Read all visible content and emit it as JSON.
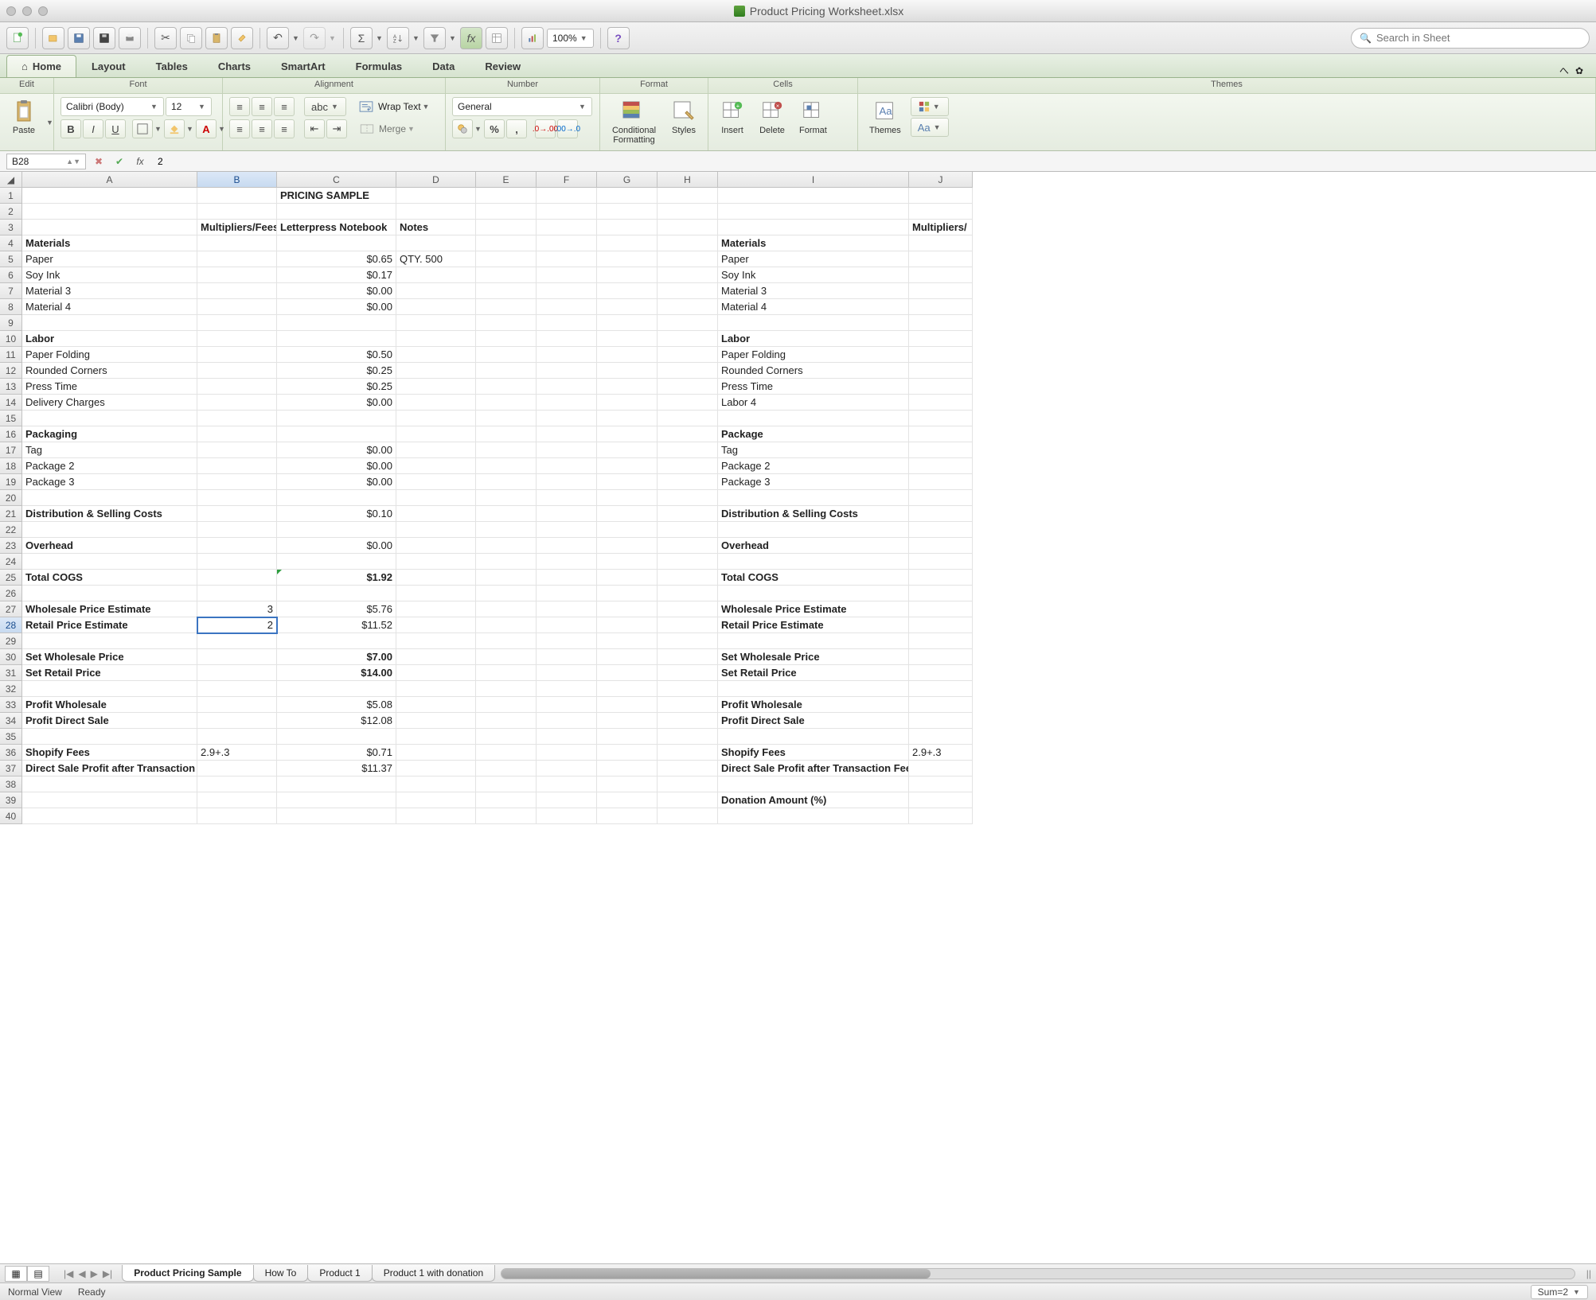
{
  "window": {
    "title": "Product Pricing Worksheet.xlsx"
  },
  "toolbar": {
    "zoom": "100%",
    "search_placeholder": "Search in Sheet"
  },
  "ribbon": {
    "tabs": [
      "Home",
      "Layout",
      "Tables",
      "Charts",
      "SmartArt",
      "Formulas",
      "Data",
      "Review"
    ],
    "active_tab": 0,
    "groups": [
      "Edit",
      "Font",
      "Alignment",
      "Number",
      "Format",
      "Cells",
      "Themes"
    ],
    "paste": "Paste",
    "font_name": "Calibri (Body)",
    "font_size": "12",
    "wrap_text": "Wrap Text",
    "merge": "Merge",
    "number_format": "General",
    "conditional_formatting": "Conditional\nFormatting",
    "styles": "Styles",
    "insert": "Insert",
    "delete": "Delete",
    "format": "Format",
    "themes": "Themes",
    "aa": "Aa"
  },
  "formula_bar": {
    "name_box": "B28",
    "formula": "2"
  },
  "columns": [
    "A",
    "B",
    "C",
    "D",
    "E",
    "F",
    "G",
    "H",
    "I",
    "J"
  ],
  "selected_cell": {
    "row": 28,
    "col": 1
  },
  "rows": [
    {
      "n": 1,
      "cells": {
        "C": {
          "v": "PRICING SAMPLE",
          "b": true
        }
      }
    },
    {
      "n": 2,
      "cells": {}
    },
    {
      "n": 3,
      "cells": {
        "B": {
          "v": "Multipliers/Fees",
          "b": true
        },
        "C": {
          "v": "Letterpress Notebook",
          "b": true
        },
        "D": {
          "v": "Notes",
          "b": true
        },
        "J": {
          "v": "Multipliers/",
          "b": true
        }
      }
    },
    {
      "n": 4,
      "cells": {
        "A": {
          "v": "Materials",
          "b": true
        },
        "I": {
          "v": "Materials",
          "b": true
        }
      }
    },
    {
      "n": 5,
      "cells": {
        "A": {
          "v": "Paper"
        },
        "C": {
          "v": "$0.65",
          "r": true
        },
        "D": {
          "v": "QTY. 500"
        },
        "I": {
          "v": "Paper"
        }
      }
    },
    {
      "n": 6,
      "cells": {
        "A": {
          "v": "Soy Ink"
        },
        "C": {
          "v": "$0.17",
          "r": true
        },
        "I": {
          "v": "Soy Ink"
        }
      }
    },
    {
      "n": 7,
      "cells": {
        "A": {
          "v": "Material 3"
        },
        "C": {
          "v": "$0.00",
          "r": true
        },
        "I": {
          "v": "Material 3"
        }
      }
    },
    {
      "n": 8,
      "cells": {
        "A": {
          "v": "Material 4"
        },
        "C": {
          "v": "$0.00",
          "r": true
        },
        "I": {
          "v": "Material 4"
        }
      }
    },
    {
      "n": 9,
      "cells": {}
    },
    {
      "n": 10,
      "cells": {
        "A": {
          "v": "Labor",
          "b": true
        },
        "I": {
          "v": "Labor",
          "b": true
        }
      }
    },
    {
      "n": 11,
      "cells": {
        "A": {
          "v": "Paper Folding"
        },
        "C": {
          "v": "$0.50",
          "r": true
        },
        "I": {
          "v": "Paper Folding"
        }
      }
    },
    {
      "n": 12,
      "cells": {
        "A": {
          "v": "Rounded Corners"
        },
        "C": {
          "v": "$0.25",
          "r": true
        },
        "I": {
          "v": "Rounded Corners"
        }
      }
    },
    {
      "n": 13,
      "cells": {
        "A": {
          "v": "Press Time"
        },
        "C": {
          "v": "$0.25",
          "r": true
        },
        "I": {
          "v": "Press Time"
        }
      }
    },
    {
      "n": 14,
      "cells": {
        "A": {
          "v": "Delivery Charges"
        },
        "C": {
          "v": "$0.00",
          "r": true
        },
        "I": {
          "v": "Labor 4"
        }
      }
    },
    {
      "n": 15,
      "cells": {}
    },
    {
      "n": 16,
      "cells": {
        "A": {
          "v": "Packaging",
          "b": true
        },
        "I": {
          "v": "Package",
          "b": true
        }
      }
    },
    {
      "n": 17,
      "cells": {
        "A": {
          "v": "Tag"
        },
        "C": {
          "v": "$0.00",
          "r": true
        },
        "I": {
          "v": "Tag"
        }
      }
    },
    {
      "n": 18,
      "cells": {
        "A": {
          "v": "Package 2"
        },
        "C": {
          "v": "$0.00",
          "r": true
        },
        "I": {
          "v": "Package 2"
        }
      }
    },
    {
      "n": 19,
      "cells": {
        "A": {
          "v": "Package 3"
        },
        "C": {
          "v": "$0.00",
          "r": true
        },
        "I": {
          "v": "Package 3"
        }
      }
    },
    {
      "n": 20,
      "cells": {}
    },
    {
      "n": 21,
      "cells": {
        "A": {
          "v": "Distribution & Selling Costs",
          "b": true
        },
        "C": {
          "v": "$0.10",
          "r": true
        },
        "I": {
          "v": "Distribution & Selling Costs",
          "b": true
        }
      }
    },
    {
      "n": 22,
      "cells": {}
    },
    {
      "n": 23,
      "cells": {
        "A": {
          "v": "Overhead",
          "b": true
        },
        "C": {
          "v": "$0.00",
          "r": true
        },
        "I": {
          "v": "Overhead",
          "b": true
        }
      }
    },
    {
      "n": 24,
      "cells": {}
    },
    {
      "n": 25,
      "cells": {
        "A": {
          "v": "Total COGS",
          "b": true
        },
        "C": {
          "v": "$1.92",
          "r": true,
          "b": true,
          "tri": true
        },
        "I": {
          "v": "Total COGS",
          "b": true
        }
      }
    },
    {
      "n": 26,
      "cells": {}
    },
    {
      "n": 27,
      "cells": {
        "A": {
          "v": "Wholesale Price Estimate",
          "b": true
        },
        "B": {
          "v": "3",
          "r": true
        },
        "C": {
          "v": "$5.76",
          "r": true
        },
        "I": {
          "v": "Wholesale Price Estimate",
          "b": true
        }
      }
    },
    {
      "n": 28,
      "cells": {
        "A": {
          "v": "Retail Price Estimate",
          "b": true
        },
        "B": {
          "v": "2",
          "r": true,
          "sel": true
        },
        "C": {
          "v": "$11.52",
          "r": true
        },
        "I": {
          "v": "Retail Price Estimate",
          "b": true
        }
      }
    },
    {
      "n": 29,
      "cells": {}
    },
    {
      "n": 30,
      "cells": {
        "A": {
          "v": "Set Wholesale Price",
          "b": true
        },
        "C": {
          "v": "$7.00",
          "r": true,
          "b": true
        },
        "I": {
          "v": "Set Wholesale Price",
          "b": true
        }
      }
    },
    {
      "n": 31,
      "cells": {
        "A": {
          "v": "Set Retail Price",
          "b": true
        },
        "C": {
          "v": "$14.00",
          "r": true,
          "b": true
        },
        "I": {
          "v": "Set Retail Price",
          "b": true
        }
      }
    },
    {
      "n": 32,
      "cells": {}
    },
    {
      "n": 33,
      "cells": {
        "A": {
          "v": "Profit Wholesale",
          "b": true
        },
        "C": {
          "v": "$5.08",
          "r": true
        },
        "I": {
          "v": "Profit Wholesale",
          "b": true
        }
      }
    },
    {
      "n": 34,
      "cells": {
        "A": {
          "v": "Profit Direct Sale",
          "b": true
        },
        "C": {
          "v": "$12.08",
          "r": true
        },
        "I": {
          "v": "Profit Direct Sale",
          "b": true
        }
      }
    },
    {
      "n": 35,
      "cells": {}
    },
    {
      "n": 36,
      "cells": {
        "A": {
          "v": "Shopify Fees",
          "b": true
        },
        "B": {
          "v": "2.9+.3"
        },
        "C": {
          "v": "$0.71",
          "r": true
        },
        "I": {
          "v": "Shopify Fees",
          "b": true
        },
        "J": {
          "v": "2.9+.3"
        }
      }
    },
    {
      "n": 37,
      "cells": {
        "A": {
          "v": "Direct Sale Profit after Transaction Fees",
          "b": true
        },
        "C": {
          "v": "$11.37",
          "r": true
        },
        "I": {
          "v": "Direct Sale Profit after Transaction Fees",
          "b": true
        }
      }
    },
    {
      "n": 38,
      "cells": {}
    },
    {
      "n": 39,
      "cells": {
        "I": {
          "v": "Donation Amount (%)",
          "b": true
        }
      }
    },
    {
      "n": 40,
      "cells": {}
    }
  ],
  "sheet_tabs": [
    "Product Pricing Sample",
    "How To",
    "Product 1",
    "Product 1 with donation"
  ],
  "active_sheet": 0,
  "status": {
    "view": "Normal View",
    "ready": "Ready",
    "sum": "Sum=2"
  }
}
